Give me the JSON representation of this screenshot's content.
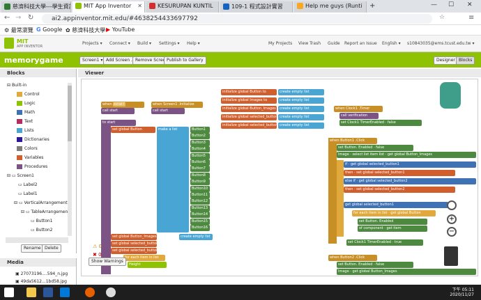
{
  "browser": {
    "tabs": [
      {
        "label": "慈濟科技大學---學生資訊",
        "color": "#2e7d32"
      },
      {
        "label": "MIT App Inventor",
        "color": "#8fc202"
      },
      {
        "label": "KESURUPAN KUNTIL",
        "color": "#d32f2f"
      },
      {
        "label": "109-1 程式設計實習",
        "color": "#1565c0"
      },
      {
        "label": "Help me guys (Runti",
        "color": "#f9a825"
      }
    ],
    "url": "ai2.appinventor.mit.edu/#4638254433697792",
    "bookmarks": [
      "最常瀏覽",
      "Google",
      "慈濟科技大學",
      "YouTube"
    ]
  },
  "ai": {
    "logo": "MIT\nAPP INVENTOR",
    "menu": [
      "Projects",
      "Connect",
      "Build",
      "Settings",
      "Help"
    ],
    "right_menu": [
      "My Projects",
      "View Trash",
      "Guide",
      "Report an Issue",
      "English",
      "s10843035@ems.tcust.edu.tw"
    ],
    "project": "memorygame",
    "buttons": [
      "Screen1",
      "Add Screen ...",
      "Remove Screen",
      "Publish to Gallery"
    ],
    "mode": [
      "Designer",
      "Blocks"
    ]
  },
  "blocks_panel": {
    "title": "Blocks",
    "builtin": "Built-in",
    "items": [
      {
        "label": "Control",
        "color": "#e1a93b"
      },
      {
        "label": "Logic",
        "color": "#8fc202"
      },
      {
        "label": "Math",
        "color": "#3f71b5"
      },
      {
        "label": "Text",
        "color": "#b32d5e"
      },
      {
        "label": "Lists",
        "color": "#49a6d4"
      },
      {
        "label": "Dictionaries",
        "color": "#2d1799"
      },
      {
        "label": "Colors",
        "color": "#7d7d7d"
      },
      {
        "label": "Variables",
        "color": "#d05f2d"
      },
      {
        "label": "Procedures",
        "color": "#7c5385"
      }
    ],
    "tree": [
      "Screen1",
      "Label2",
      "Label1",
      "VerticalArrangement1",
      "TableArrangement1",
      "Button1",
      "Button2"
    ],
    "rename": "Rename",
    "delete": "Delete",
    "media": "Media",
    "files": [
      "27073196....594_n.jpg",
      "49da5612...1bd58.jpg"
    ]
  },
  "viewer": {
    "title": "Viewer",
    "show_warnings": "Show Warnings",
    "warn_count": "0",
    "err_count": "0"
  },
  "workspace": {
    "when_reset": "when",
    "reset_name": "RESET",
    "click": ".Click",
    "when_screen": "when",
    "screen_name": "Screen1",
    "init": ".Initialize",
    "call": "call",
    "start": "start",
    "to": "to",
    "do": "do",
    "set_global_button": "set global Button",
    "make_list": "make a list",
    "buttons": [
      "Button1",
      "Button2",
      "Button3",
      "Button4",
      "Button5",
      "Button6",
      "Button7",
      "Button8",
      "Button9",
      "Button10",
      "Button11",
      "Button12",
      "Button13",
      "Button14",
      "Button15",
      "Button16"
    ],
    "globals": [
      "initialize global Button to",
      "initialize global Images to",
      "initialize global Button_Images to",
      "initialize global selected_button1 to",
      "initialize global selected_button2 to"
    ],
    "create_empty_list": "create empty list",
    "clock_when": "when",
    "clock": "Clock1",
    "timer": ".Timer",
    "verification": "verification",
    "set_clock": "set Clock1",
    "timer_enabled": "TimerEnabled",
    "false": "false",
    "true": "true",
    "when_button1": "when Button1",
    "when_button2": "when Button2",
    "enabled": "Enabled",
    "image": "Image",
    "select_list_item": "select list item list",
    "get_global_button_images": "get global Button_Images",
    "index": "index",
    "one": "1",
    "two": "2",
    "get_global_selected_button1": "get global selected_button1",
    "get_global_selected_button2": "get global selected_button2",
    "if": "if",
    "then": "then",
    "else_if": "else if",
    "for_each_item": "for each item in list",
    "get_global_button": "get global Button",
    "set_button": "set Button. Enabled",
    "of_component": "of component",
    "get_item": "get item",
    "to_label": "to",
    "set_global_button_images": "set global Button_Images",
    "set_global_sel1": "set global selected_button1",
    "set_global_sel2": "set global selected_button2",
    "height": "Height"
  },
  "taskbar": {
    "time": "下午 05:11",
    "date": "2020/11/27"
  }
}
